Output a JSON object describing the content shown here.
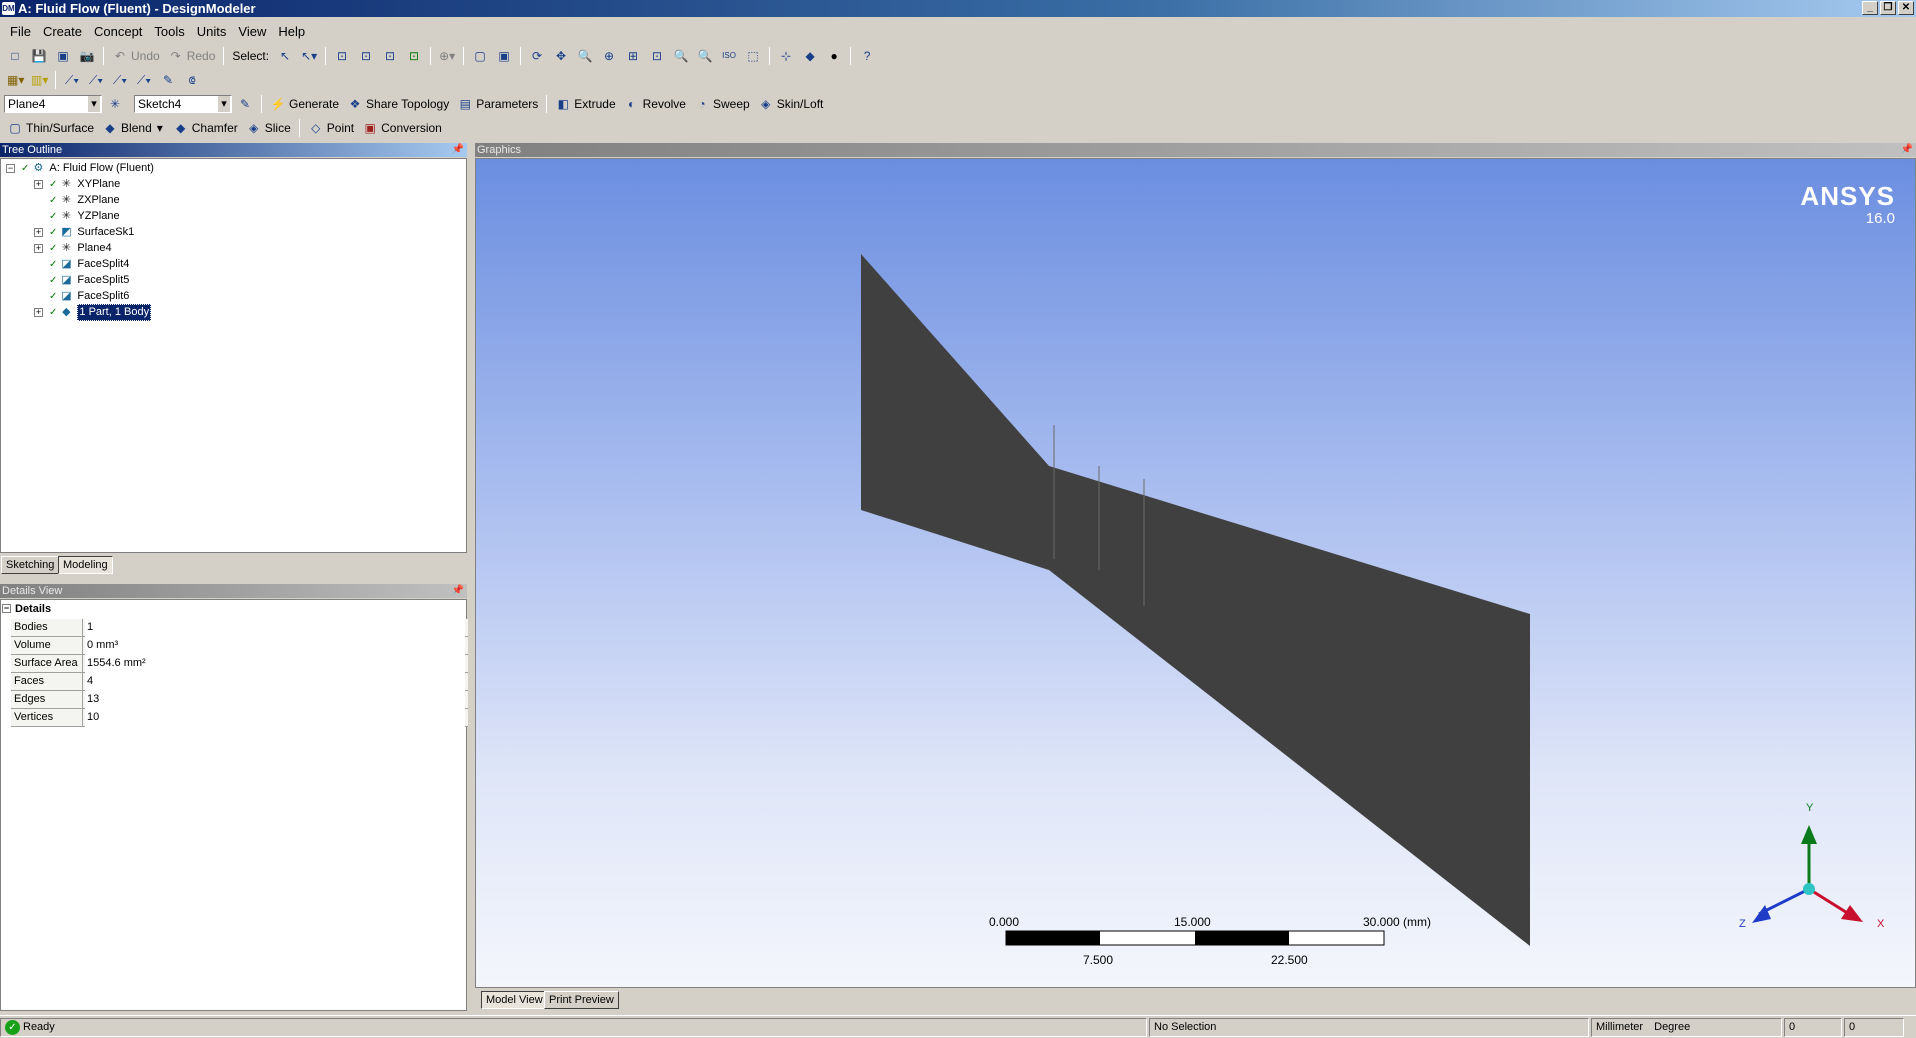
{
  "window": {
    "title": "A: Fluid Flow (Fluent) - DesignModeler",
    "app_icon": "DM"
  },
  "menu": [
    "File",
    "Create",
    "Concept",
    "Tools",
    "Units",
    "View",
    "Help"
  ],
  "toolbar1": {
    "undo": "Undo",
    "redo": "Redo",
    "select": "Select:"
  },
  "toolbar3": {
    "plane_combo": "Plane4",
    "sketch_combo": "Sketch4",
    "generate": "Generate",
    "share_topology": "Share Topology",
    "parameters": "Parameters",
    "extrude": "Extrude",
    "revolve": "Revolve",
    "sweep": "Sweep",
    "skin_loft": "Skin/Loft"
  },
  "toolbar4": {
    "thin_surface": "Thin/Surface",
    "blend": "Blend",
    "chamfer": "Chamfer",
    "slice": "Slice",
    "point": "Point",
    "conversion": "Conversion"
  },
  "tree": {
    "header": "Tree Outline",
    "root": "A: Fluid Flow (Fluent)",
    "items": [
      {
        "label": "XYPlane",
        "expandable": true,
        "icon": "plane-icon"
      },
      {
        "label": "ZXPlane",
        "expandable": false,
        "icon": "plane-icon"
      },
      {
        "label": "YZPlane",
        "expandable": false,
        "icon": "plane-icon"
      },
      {
        "label": "SurfaceSk1",
        "expandable": true,
        "icon": "surface-icon"
      },
      {
        "label": "Plane4",
        "expandable": true,
        "icon": "plane-icon"
      },
      {
        "label": "FaceSplit4",
        "expandable": false,
        "icon": "facesplit-icon"
      },
      {
        "label": "FaceSplit5",
        "expandable": false,
        "icon": "facesplit-icon"
      },
      {
        "label": "FaceSplit6",
        "expandable": false,
        "icon": "facesplit-icon"
      },
      {
        "label": "1 Part, 1 Body",
        "expandable": true,
        "icon": "body-icon",
        "selected": true
      }
    ]
  },
  "tabs": {
    "sketching": "Sketching",
    "modeling": "Modeling"
  },
  "details": {
    "header": "Details View",
    "section": "Details",
    "rows": [
      {
        "k": "Bodies",
        "v": "1"
      },
      {
        "k": "Volume",
        "v": "0 mm³"
      },
      {
        "k": "Surface Area",
        "v": "1554.6 mm²"
      },
      {
        "k": "Faces",
        "v": "4"
      },
      {
        "k": "Edges",
        "v": "13"
      },
      {
        "k": "Vertices",
        "v": "10"
      }
    ]
  },
  "graphics": {
    "header": "Graphics",
    "brand": "ANSYS",
    "version": "16.0",
    "scale": {
      "top": [
        "0.000",
        "15.000",
        "30.000 (mm)"
      ],
      "bottom": [
        "7.500",
        "22.500"
      ]
    },
    "axes": {
      "x": "X",
      "y": "Y",
      "z": "Z"
    },
    "colors": {
      "body": "#404040",
      "x_axis": "#c8102e",
      "y_axis": "#0a7a1a",
      "z_axis": "#1e3cc8",
      "triad_center": "#2ec4c4"
    }
  },
  "graphics_tabs": {
    "model_view": "Model View",
    "print_preview": "Print Preview"
  },
  "status": {
    "ready": "Ready",
    "selection": "No Selection",
    "units": "Millimeter",
    "angle": "Degree",
    "v1": "0",
    "v2": "0"
  }
}
